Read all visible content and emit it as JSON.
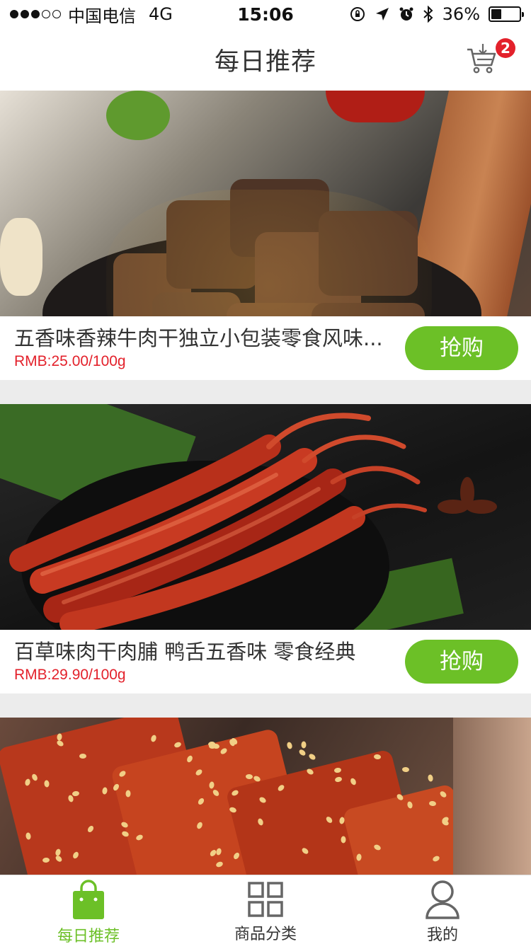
{
  "status_bar": {
    "carrier": "中国电信",
    "network": "4G",
    "time": "15:06",
    "battery": "36%",
    "battery_level": 0.36
  },
  "header": {
    "title": "每日推荐",
    "cart_count": "2"
  },
  "products": [
    {
      "title": "五香味香辣牛肉干独立小包装零食风味...",
      "price": "RMB:25.00/100g",
      "buy_label": "抢购"
    },
    {
      "title": "百草味肉干肉脯 鸭舌五香味 零食经典",
      "price": "RMB:29.90/100g",
      "buy_label": "抢购"
    }
  ],
  "tabs": [
    {
      "label": "每日推荐",
      "icon": "shopping-bag-icon",
      "active": true
    },
    {
      "label": "商品分类",
      "icon": "grid-icon",
      "active": false
    },
    {
      "label": "我的",
      "icon": "user-icon",
      "active": false
    }
  ],
  "colors": {
    "accent": "#6cc027",
    "price": "#e3212b",
    "badge": "#e3212b"
  }
}
